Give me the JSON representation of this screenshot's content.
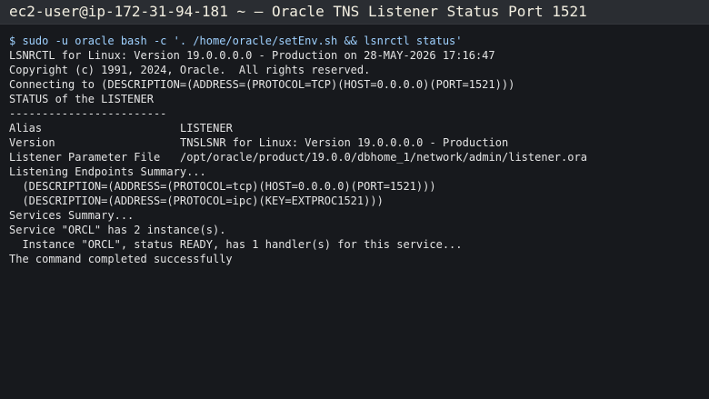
{
  "window": {
    "title": "ec2-user@ip-172-31-94-181 ~ — Oracle TNS Listener Status Port 1521"
  },
  "terminal": {
    "command": "$ sudo -u oracle bash -c '. /home/oracle/setEnv.sh && lsnrctl status'",
    "banner": [
      "LSNRCTL for Linux: Version 19.0.0.0.0 - Production on 28-MAY-2026 17:16:47",
      "Copyright (c) 1991, 2024, Oracle.  All rights reserved.",
      "Connecting to (DESCRIPTION=(ADDRESS=(PROTOCOL=TCP)(HOST=0.0.0.0)(PORT=1521)))",
      "STATUS of the LISTENER",
      "------------------------"
    ],
    "fields": [
      {
        "key": "Alias",
        "value": "LISTENER"
      },
      {
        "key": "Version",
        "value": "TNSLSNR for Linux: Version 19.0.0.0.0 - Production"
      },
      {
        "key": "Listener Parameter File",
        "value": "/opt/oracle/product/19.0.0/dbhome_1/network/admin/listener.ora"
      }
    ],
    "footer": [
      "Listening Endpoints Summary...",
      "  (DESCRIPTION=(ADDRESS=(PROTOCOL=tcp)(HOST=0.0.0.0)(PORT=1521)))",
      "  (DESCRIPTION=(ADDRESS=(PROTOCOL=ipc)(KEY=EXTPROC1521)))",
      "Services Summary...",
      "Service \"ORCL\" has 2 instance(s).",
      "  Instance \"ORCL\", status READY, has 1 handler(s) for this service...",
      "The command completed successfully"
    ]
  },
  "colors": {
    "background": "#17191d",
    "titlebar": "#2a2d32",
    "title_text": "#f2eee0",
    "prompt": "#9fd1ff",
    "output": "#e4e4e4"
  }
}
